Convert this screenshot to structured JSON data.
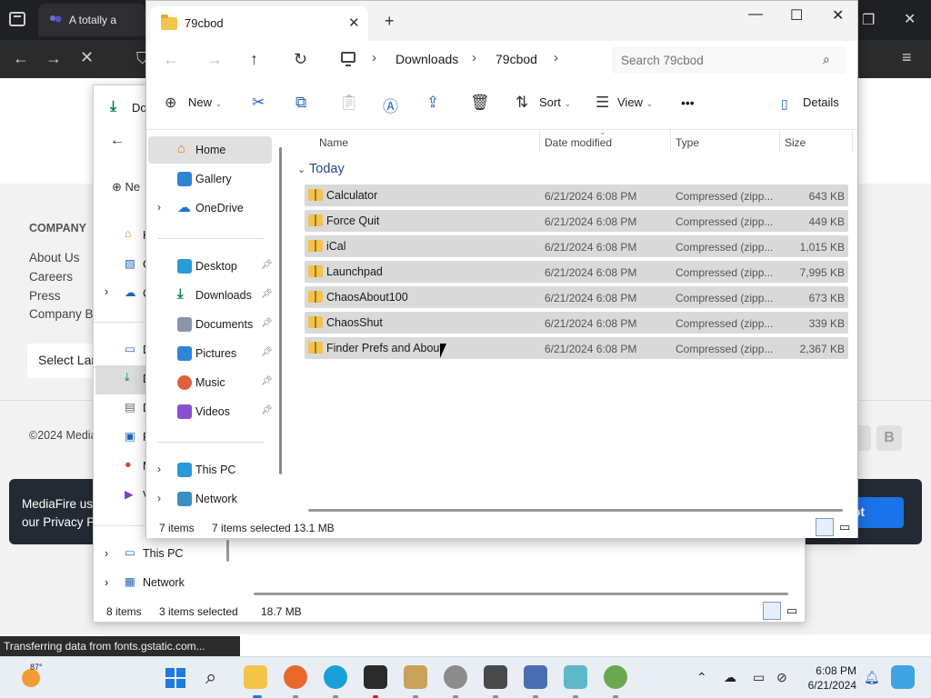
{
  "browser": {
    "tab_title": "A totally a",
    "status_text": "Transferring data from fonts.gstatic.com...",
    "extension_badge": "21"
  },
  "webpage": {
    "company_heading": "COMPANY",
    "links": [
      "About Us",
      "Careers",
      "Press",
      "Company Bl"
    ],
    "language_button": "Select Lan",
    "copyright": "©2024 Media",
    "cookie_text_line1": "MediaFire use",
    "cookie_text_line2": "our Privacy P",
    "accept_label": "ept",
    "social_b": "B"
  },
  "back_window": {
    "tab_label": "Do",
    "new_label": "Ne",
    "sidebar_partial": [
      "H",
      "G",
      "C",
      "D",
      "D",
      "D",
      "P",
      "M",
      "V"
    ],
    "this_pc": "This PC",
    "network": "Network",
    "status_items": "8 items",
    "status_selected": "3 items selected",
    "status_size": "18.7 MB"
  },
  "front_window": {
    "tab_label": "79cbod",
    "breadcrumbs": [
      "Downloads",
      "79cbod"
    ],
    "search_placeholder": "Search 79cbod",
    "toolbar": {
      "new_label": "New",
      "sort_label": "Sort",
      "view_label": "View",
      "more_label": "•••",
      "details_label": "Details"
    },
    "sidebar": {
      "home": "Home",
      "gallery": "Gallery",
      "onedrive": "OneDrive",
      "desktop": "Desktop",
      "downloads": "Downloads",
      "documents": "Documents",
      "pictures": "Pictures",
      "music": "Music",
      "videos": "Videos",
      "this_pc": "This PC",
      "network": "Network"
    },
    "columns": {
      "name": "Name",
      "date": "Date modified",
      "type": "Type",
      "size": "Size"
    },
    "group": "Today",
    "files": [
      {
        "name": "Calculator",
        "date": "6/21/2024 6:08 PM",
        "type": "Compressed (zipp...",
        "size": "643 KB"
      },
      {
        "name": "Force Quit",
        "date": "6/21/2024 6:08 PM",
        "type": "Compressed (zipp...",
        "size": "449 KB"
      },
      {
        "name": "iCal",
        "date": "6/21/2024 6:08 PM",
        "type": "Compressed (zipp...",
        "size": "1,015 KB"
      },
      {
        "name": "Launchpad",
        "date": "6/21/2024 6:08 PM",
        "type": "Compressed (zipp...",
        "size": "7,995 KB"
      },
      {
        "name": "ChaosAbout100",
        "date": "6/21/2024 6:08 PM",
        "type": "Compressed (zipp...",
        "size": "673 KB"
      },
      {
        "name": "ChaosShut",
        "date": "6/21/2024 6:08 PM",
        "type": "Compressed (zipp...",
        "size": "339 KB"
      },
      {
        "name": "Finder Prefs and About",
        "date": "6/21/2024 6:08 PM",
        "type": "Compressed (zipp...",
        "size": "2,367 KB"
      }
    ],
    "status_items": "7 items",
    "status_selected": "7 items selected",
    "status_size": "13.1 MB"
  },
  "taskbar": {
    "weather_temp": "87°",
    "time": "6:08 PM",
    "date": "6/21/2024"
  },
  "colors": {
    "accent": "#1c64b8",
    "selection": "#d9d9d9",
    "folder": "#f3c34a",
    "cookie_bg": "#242a33",
    "accept_bg": "#1a73e8"
  }
}
